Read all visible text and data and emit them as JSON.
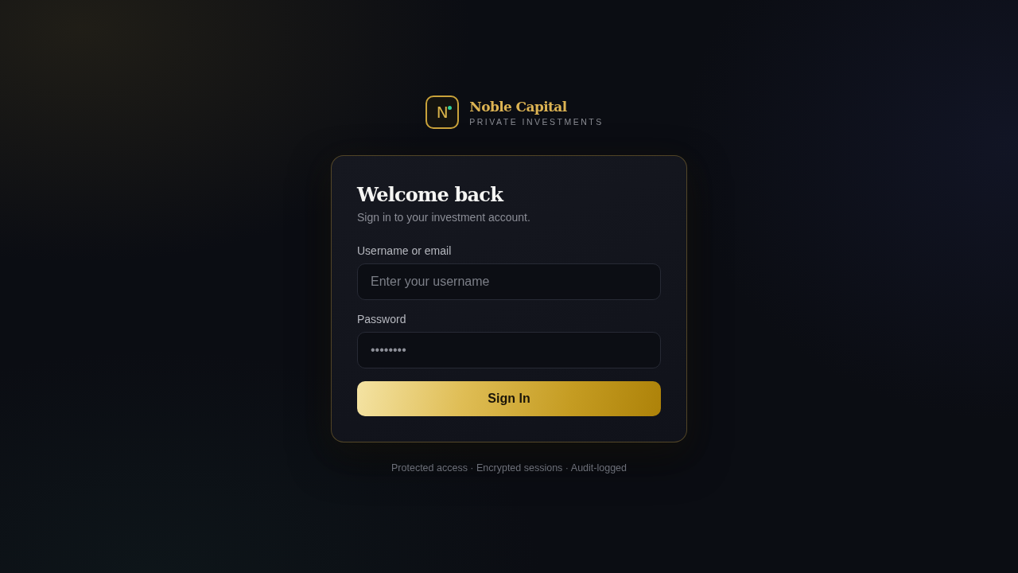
{
  "brand": {
    "mark": "N",
    "name": "Noble Capital",
    "tagline": "PRIVATE INVESTMENTS"
  },
  "card": {
    "title": "Welcome back",
    "subtitle": "Sign in to your investment account.",
    "fields": [
      {
        "label": "Username or email",
        "placeholder": "Enter your username"
      },
      {
        "label": "Password",
        "value": "••••••••"
      }
    ],
    "button": "Sign In"
  },
  "footer": "Protected access · Encrypted sessions · Audit-logged"
}
